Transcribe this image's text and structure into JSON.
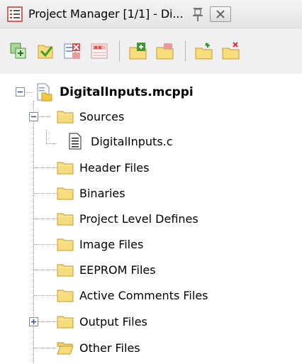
{
  "window": {
    "title": "Project Manager [1/1] - Di...",
    "icons": {
      "title": "list-icon",
      "pin": "pin-icon",
      "close": "close-icon"
    }
  },
  "toolbar": {
    "buttons": [
      {
        "icon": "copy-project-icon"
      },
      {
        "icon": "build-project-icon"
      },
      {
        "icon": "remove-file-icon"
      },
      {
        "icon": "remove-all-files-icon"
      },
      {
        "icon": "add-folder-icon"
      },
      {
        "icon": "remove-folder-icon"
      },
      {
        "icon": "add-file-icon"
      },
      {
        "icon": "delete-file-icon"
      }
    ]
  },
  "tree": {
    "project": {
      "name": "DigitalInputs.mcppi",
      "expanded": true
    },
    "nodes": [
      {
        "label": "Sources",
        "expander": "minus",
        "children": [
          {
            "label": "DigitalInputs.c"
          }
        ]
      },
      {
        "label": "Header Files"
      },
      {
        "label": "Binaries"
      },
      {
        "label": "Project Level Defines"
      },
      {
        "label": "Image Files"
      },
      {
        "label": "EEPROM Files"
      },
      {
        "label": "Active Comments Files"
      },
      {
        "label": "Output Files",
        "expander": "plus"
      },
      {
        "label": "Other Files",
        "open": true
      }
    ]
  },
  "colors": {
    "folder_fill": "#f7dc7b",
    "folder_stroke": "#c49a2c",
    "expander_border": "#8a8a8a",
    "titlebar": "#ececec",
    "toolbar": "#f0f0f0"
  }
}
